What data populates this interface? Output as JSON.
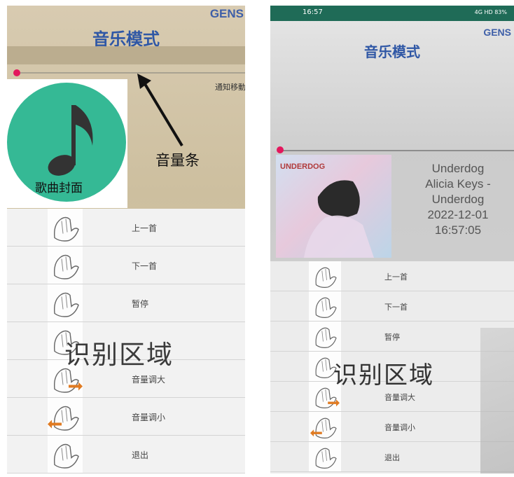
{
  "left": {
    "brand": "GENS",
    "title": "音乐模式",
    "notice_text": "通知移動",
    "cover_label": "歌曲封面",
    "annotation": "音量条",
    "region_label": "识别区域",
    "gestures": [
      "上一首",
      "下一首",
      "暂停",
      "",
      "音量调大",
      "音量调小",
      "退出"
    ]
  },
  "right": {
    "status_time": "16:57",
    "status_right": "4G HD 83%",
    "brand": "GENS",
    "title": "音乐模式",
    "album_text": "UNDERDOG",
    "song_lines": [
      "Underdog",
      "Alicia Keys -",
      "Underdog",
      "2022-12-01",
      "16:57:05"
    ],
    "region_label": "识别区域",
    "gestures": [
      "上一首",
      "下一首",
      "暂停",
      "",
      "音量调大",
      "音量调小",
      "退出"
    ]
  },
  "colors": {
    "brand_blue": "#2f57a5",
    "cover_green": "#35b995",
    "slider_pink": "#e3175d",
    "gesture_arrow": "#e07b22",
    "statusbar": "#1f6b57"
  }
}
